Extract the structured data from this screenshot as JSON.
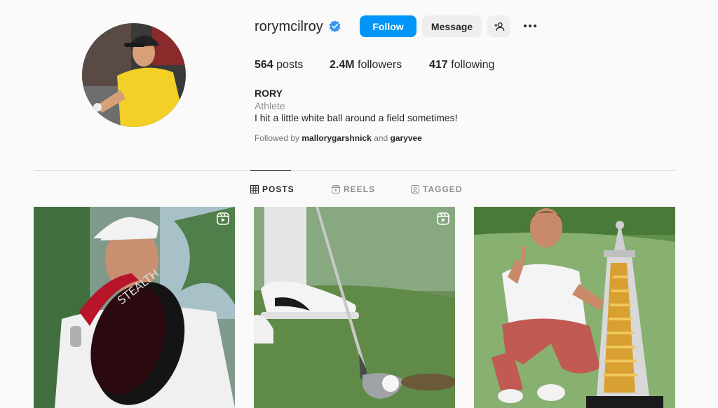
{
  "profile": {
    "username": "rorymcilroy",
    "verified_icon": "verified-badge-icon",
    "follow_label": "Follow",
    "message_label": "Message",
    "add_user_icon": "add-user-icon",
    "more_icon": "more-options-icon",
    "posts_count": "564",
    "posts_label": "posts",
    "followers_count": "2.4M",
    "followers_label": "followers",
    "following_count": "417",
    "following_label": "following",
    "full_name": "RORY",
    "category": "Athlete",
    "bio": "I hit a little white ball around a field sometimes!",
    "followed_by_prefix": "Followed by",
    "followed_by_user1": "mallorygarshnick",
    "followed_by_and": "and",
    "followed_by_user2": "garyvee"
  },
  "tabs": [
    {
      "label": "POSTS",
      "icon": "grid-icon",
      "active": true
    },
    {
      "label": "REELS",
      "icon": "reels-icon",
      "active": false
    },
    {
      "label": "TAGGED",
      "icon": "tagged-icon",
      "active": false
    }
  ],
  "posts": [
    {
      "type": "reel",
      "icon": "reel-icon",
      "subject": "golfer holding driver"
    },
    {
      "type": "reel",
      "icon": "reel-icon",
      "subject": "golf shoes and wedge on grass"
    },
    {
      "type": "photo",
      "subject": "golfer kneeling with trophy"
    }
  ],
  "colors": {
    "accent": "#0095f6",
    "background": "#fafafa",
    "button_secondary": "#efefef",
    "text_primary": "#262626",
    "text_secondary": "#8e8e8e"
  }
}
